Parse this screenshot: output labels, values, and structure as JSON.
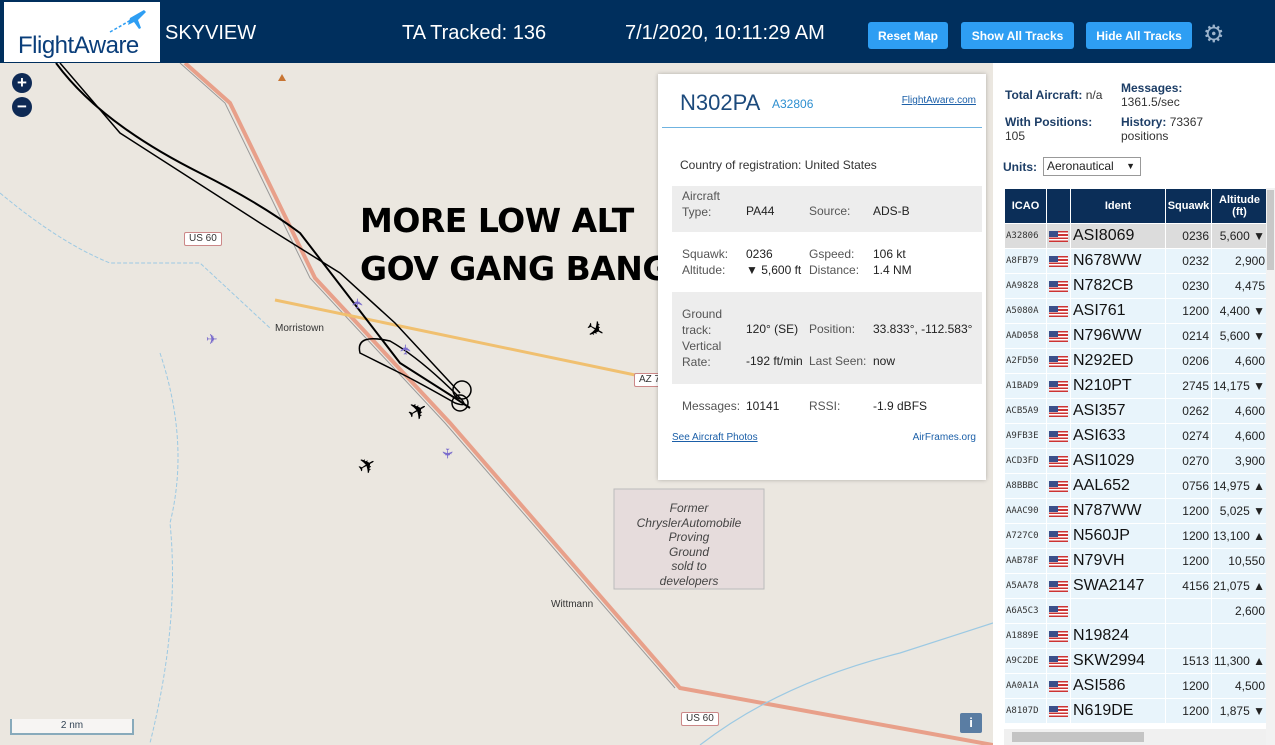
{
  "header": {
    "logo": "FlightAware",
    "app_title": "SKYVIEW",
    "ta_tracked": "TA Tracked: 136",
    "datetime": "7/1/2020, 10:11:29 AM",
    "buttons": {
      "reset_map": "Reset Map",
      "show_all": "Show All Tracks",
      "hide_all": "Hide All Tracks"
    },
    "settings_icon": "gear-icon"
  },
  "map": {
    "zoom_in": "+",
    "zoom_out": "−",
    "overlay_line1": "MORE LOW ALT",
    "overlay_line2": "GOV GANG BANGING",
    "places": {
      "morristown": "Morristown",
      "wittmann": "Wittmann"
    },
    "roads": {
      "us60_a": "US 60",
      "az74": "AZ 7",
      "us60_b": "US 60"
    },
    "former_lines": [
      "Former",
      "ChryslerAutomobile",
      "Proving",
      "Ground",
      "sold to",
      "developers"
    ],
    "scale": "2 nm",
    "info": "i"
  },
  "popup": {
    "callsign": "N302PA",
    "hex": "A32806",
    "fa_link": "FlightAware.com",
    "country_label": "Country of registration:",
    "country": "United States",
    "aircraft_type_label": "Aircraft\nType:",
    "aircraft_type": "PA44",
    "source_label": "Source:",
    "source": "ADS-B",
    "squawk_label": "Squawk:",
    "squawk": "0236",
    "gspeed_label": "Gspeed:",
    "gspeed": "106 kt",
    "altitude_label": "Altitude:",
    "altitude": "▼ 5,600 ft",
    "distance_label": "Distance:",
    "distance": "1.4 NM",
    "track_label": "Ground\ntrack:",
    "track": "120° (SE)",
    "position_label": "Position:",
    "position": "33.833°, -112.583°",
    "vrate_label": "Vertical\nRate:",
    "vrate": "-192 ft/min",
    "lastseen_label": "Last Seen:",
    "lastseen": "now",
    "messages_label": "Messages:",
    "messages": "10141",
    "rssi_label": "RSSI:",
    "rssi": "-1.9 dBFS",
    "photos_link": "See Aircraft Photos",
    "airframes_link": "AirFrames.org"
  },
  "stats": {
    "total_label": "Total Aircraft:",
    "total": "n/a",
    "messages_label": "Messages:",
    "messages": "1361.5/sec",
    "with_pos_label": "With Positions:",
    "with_pos": "105",
    "history_label": "History:",
    "history": "73367 positions",
    "units_label": "Units:",
    "units": "Aeronautical"
  },
  "table": {
    "headers": [
      "ICAO",
      "",
      "Ident",
      "Squawk",
      "Altitude (ft)"
    ],
    "rows": [
      {
        "icao": "A32806",
        "ident": "ASI8069",
        "squawk": "0236",
        "alt": "5,600 ▼"
      },
      {
        "icao": "A8FB79",
        "ident": "N678WW",
        "squawk": "0232",
        "alt": "2,900"
      },
      {
        "icao": "AA9828",
        "ident": "N782CB",
        "squawk": "0230",
        "alt": "4,475"
      },
      {
        "icao": "A5080A",
        "ident": "ASI761",
        "squawk": "1200",
        "alt": "4,400 ▼"
      },
      {
        "icao": "AAD058",
        "ident": "N796WW",
        "squawk": "0214",
        "alt": "5,600 ▼"
      },
      {
        "icao": "A2FD50",
        "ident": "N292ED",
        "squawk": "0206",
        "alt": "4,600"
      },
      {
        "icao": "A1BAD9",
        "ident": "N210PT",
        "squawk": "2745",
        "alt": "14,175 ▼"
      },
      {
        "icao": "ACB5A9",
        "ident": "ASI357",
        "squawk": "0262",
        "alt": "4,600"
      },
      {
        "icao": "A9FB3E",
        "ident": "ASI633",
        "squawk": "0274",
        "alt": "4,600"
      },
      {
        "icao": "ACD3FD",
        "ident": "ASI1029",
        "squawk": "0270",
        "alt": "3,900"
      },
      {
        "icao": "A8BBBC",
        "ident": "AAL652",
        "squawk": "0756",
        "alt": "14,975 ▲"
      },
      {
        "icao": "AAAC90",
        "ident": "N787WW",
        "squawk": "1200",
        "alt": "5,025 ▼"
      },
      {
        "icao": "A727C0",
        "ident": "N560JP",
        "squawk": "1200",
        "alt": "13,100 ▲"
      },
      {
        "icao": "AAB78F",
        "ident": "N79VH",
        "squawk": "1200",
        "alt": "10,550"
      },
      {
        "icao": "A5AA78",
        "ident": "SWA2147",
        "squawk": "4156",
        "alt": "21,075 ▲"
      },
      {
        "icao": "A6A5C3",
        "ident": "",
        "squawk": "",
        "alt": "2,600"
      },
      {
        "icao": "A1889E",
        "ident": "N19824",
        "squawk": "",
        "alt": ""
      },
      {
        "icao": "A9C2DE",
        "ident": "SKW2994",
        "squawk": "1513",
        "alt": "11,300 ▲"
      },
      {
        "icao": "AA0A1A",
        "ident": "ASI586",
        "squawk": "1200",
        "alt": "4,500"
      },
      {
        "icao": "A8107D",
        "ident": "N619DE",
        "squawk": "1200",
        "alt": "1,875 ▼"
      }
    ]
  }
}
